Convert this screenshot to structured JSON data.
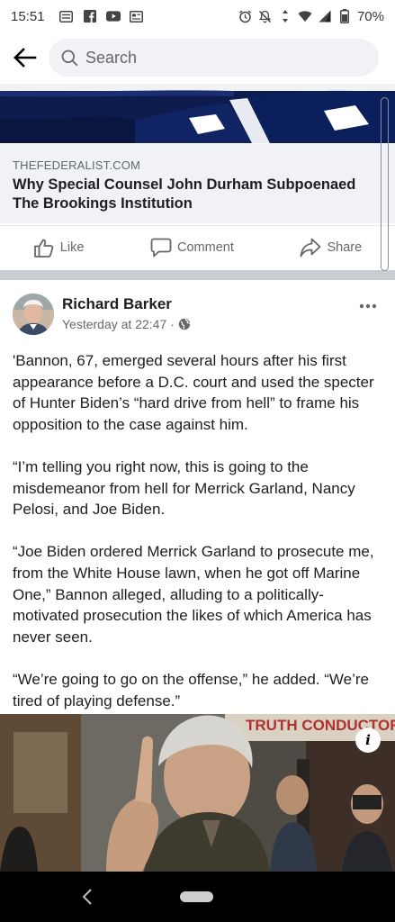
{
  "status_bar": {
    "time": "15:51",
    "battery": "70%",
    "left_icons": [
      "message-icon",
      "facebook-icon",
      "youtube-icon",
      "news-icon"
    ],
    "right_icons": [
      "alarm-icon",
      "mute-icon",
      "data-icon",
      "wifi-icon",
      "signal-icon",
      "battery-icon"
    ]
  },
  "search": {
    "placeholder": "Search"
  },
  "link_preview": {
    "domain": "THEFEDERALIST.COM",
    "title": "Why Special Counsel John Durham Subpoenaed The Brookings Institution"
  },
  "actions": {
    "like": "Like",
    "comment": "Comment",
    "share": "Share"
  },
  "post": {
    "author": "Richard Barker",
    "timestamp": "Yesterday at 22:47",
    "separator": "·",
    "paragraphs": [
      "'Bannon, 67, emerged several hours after his first appearance before a D.C. court and used the specter of Hunter Biden’s “hard drive from hell” to frame his opposition to the case against him.",
      "“I’m telling you right now, this is going to the misdemeanor from hell for Merrick Garland, Nancy Pelosi, and Joe Biden.",
      "“Joe Biden ordered Merrick Garland to prosecute me, from the White House lawn, when he got off Marine One,” Bannon alleged, alluding to a politically-motivated prosecution the likes of which America has never seen.",
      "“We’re going to go on the offense,” he added. “We’re tired of playing defense.”"
    ],
    "photo_sign_text": "TRUTH CONDUCTOR",
    "info_badge": "i"
  },
  "colors": {
    "accent_gray": "#65676b",
    "link_bg": "#f0f2f5",
    "separator": "#c9ccd1"
  }
}
